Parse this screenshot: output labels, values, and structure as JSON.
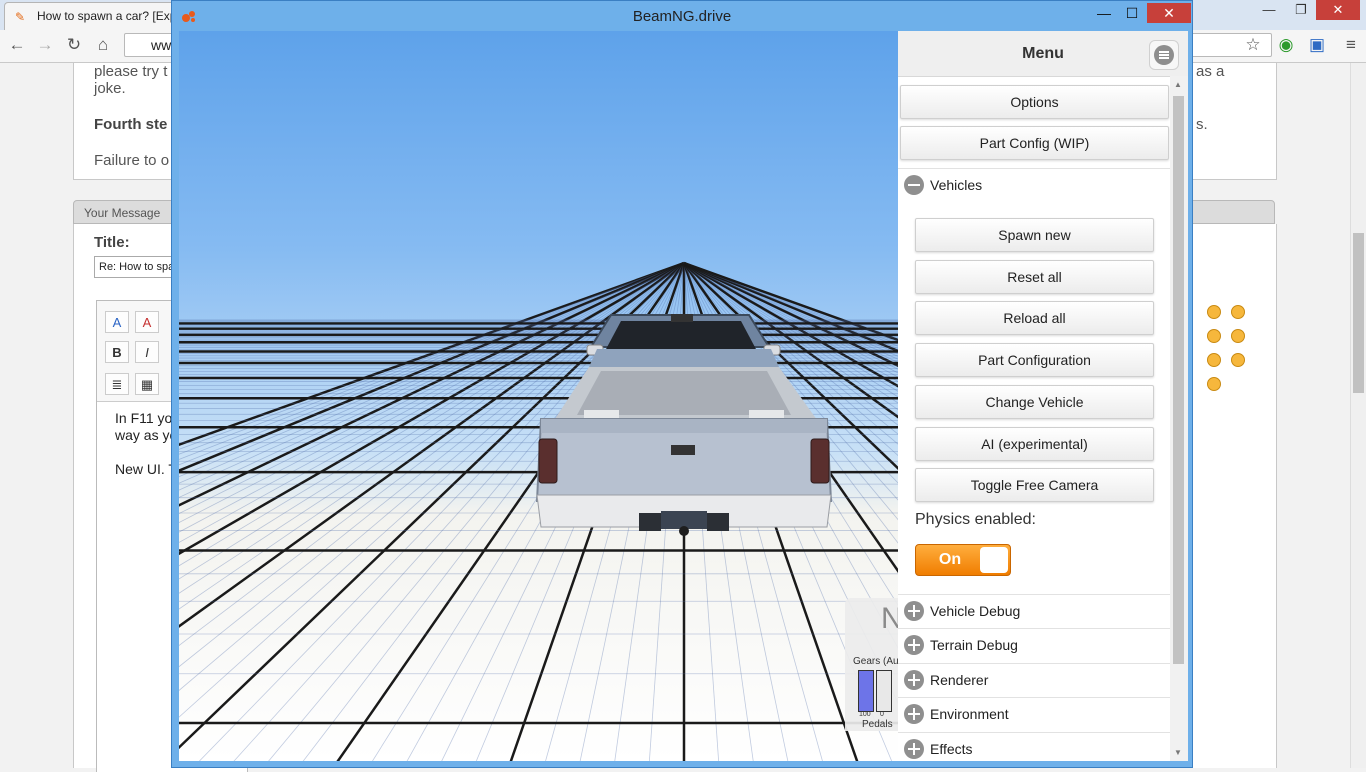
{
  "browser": {
    "tab_title": "How to spawn a car? [Exp",
    "address_text": "ww",
    "win_minimize": "—",
    "win_maximize": "❐",
    "win_close": "✕"
  },
  "page": {
    "post_line1": "please try t",
    "post_line1_right": "as a",
    "post_line2": "joke.",
    "post_fourth": "Fourth ste",
    "post_fourth_right": "s.",
    "post_failure": "Failure to o",
    "your_message": "Your Message",
    "title_label": "Title:",
    "title_value": "Re: How to spa",
    "editor_line1": "In F11 yo",
    "editor_line2": "way as yo",
    "editor_line3": "New UI. T"
  },
  "beamng": {
    "window_title": "BeamNG.drive",
    "minimize": "—",
    "maximize": "☐",
    "close": "✕"
  },
  "menu": {
    "title": "Menu",
    "top_buttons": [
      "Options",
      "Part Config (WIP)"
    ],
    "vehicles_label": "Vehicles",
    "vehicle_buttons": [
      "Spawn new",
      "Reset all",
      "Reload all",
      "Part Configuration",
      "Change Vehicle",
      "AI (experimental)",
      "Toggle Free Camera"
    ],
    "physics_label": "Physics enabled:",
    "physics_state": "On",
    "sections": [
      "Vehicle Debug",
      "Terrain Debug",
      "Renderer",
      "Environment",
      "Effects"
    ]
  },
  "gauge": {
    "gear": "N",
    "gears_label": "Gears (Au",
    "bar1_value": "100",
    "bar2_value": "0",
    "pedals_label": "Pedals"
  },
  "colors": {
    "physics_on": "#f07d00",
    "window_border": "#6eb0ea"
  }
}
